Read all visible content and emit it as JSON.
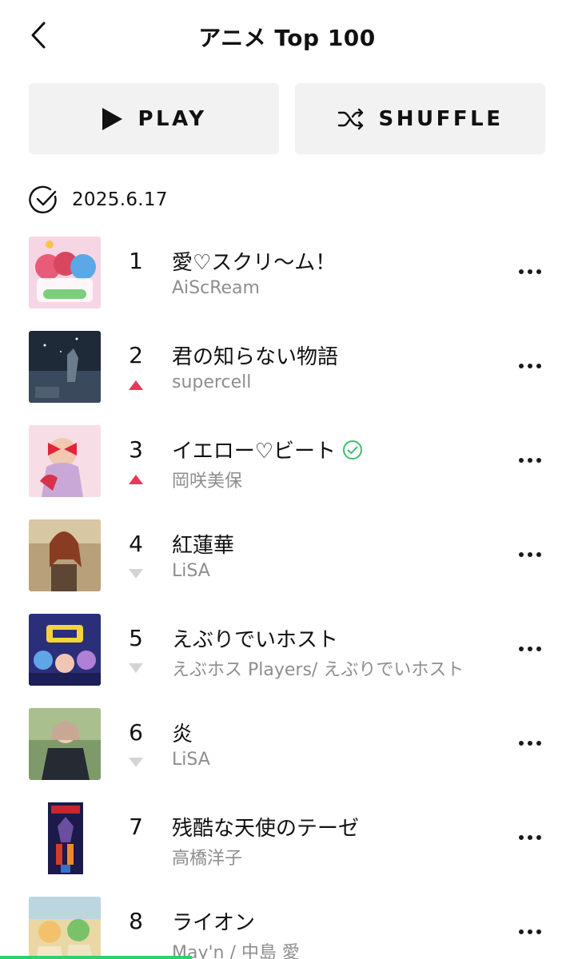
{
  "header": {
    "title": "アニメ Top 100",
    "back_icon": "chevron-left-icon"
  },
  "actions": {
    "play_label": "PLAY",
    "shuffle_label": "SHUFFLE"
  },
  "date": {
    "text": "2025.6.17",
    "icon": "check-circle-icon"
  },
  "colors": {
    "up": "#e8385a",
    "down": "#d4d4d4",
    "verified": "#3ebf6a",
    "accent_bar": "#2bd46a"
  },
  "tracks": [
    {
      "rank": "1",
      "title": "愛♡スクリ〜ム！",
      "artist": "AiScReam",
      "trend": "none",
      "verified": false
    },
    {
      "rank": "2",
      "title": "君の知らない物語",
      "artist": "supercell",
      "trend": "up",
      "verified": false
    },
    {
      "rank": "3",
      "title": "イエロー♡ビート",
      "artist": "岡咲美保",
      "trend": "up",
      "verified": true
    },
    {
      "rank": "4",
      "title": "紅蓮華",
      "artist": "LiSA",
      "trend": "down",
      "verified": false
    },
    {
      "rank": "5",
      "title": "えぶりでいホスト",
      "artist": "えぶホス Players/ えぶりでいホスト",
      "trend": "down",
      "verified": false
    },
    {
      "rank": "6",
      "title": "炎",
      "artist": "LiSA",
      "trend": "down",
      "verified": false
    },
    {
      "rank": "7",
      "title": "残酷な天使のテーゼ",
      "artist": "高橋洋子",
      "trend": "none",
      "verified": false
    },
    {
      "rank": "8",
      "title": "ライオン",
      "artist": "May'n / 中島 愛",
      "trend": "none",
      "verified": false
    }
  ]
}
